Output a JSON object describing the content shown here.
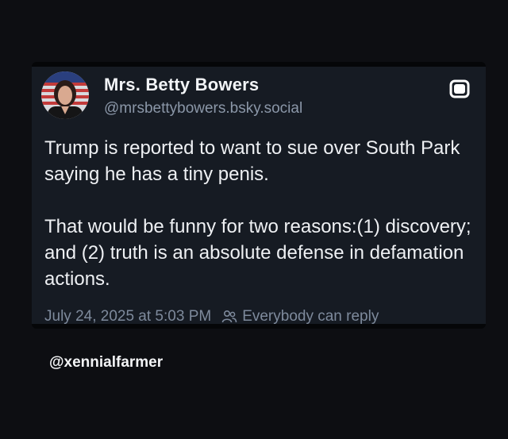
{
  "post": {
    "display_name": "Mrs. Betty Bowers",
    "handle": "@mrsbettybowers.bsky.social",
    "paragraphs": [
      "Trump is reported to want to sue over South Park saying he has a tiny penis.",
      "That would be funny for two reasons:(1) discovery; and (2) truth is an absolute defense in defamation actions."
    ],
    "timestamp": "July 24, 2025 at 5:03 PM",
    "reply_setting": "Everybody can reply",
    "icons": {
      "avatar": "profile-photo",
      "top_right": "bluesky-square-icon",
      "reply_setting": "people-icon"
    }
  },
  "watermark": {
    "text": "@xennialfarmer"
  },
  "colors": {
    "page_background": "#0d0e12",
    "card_background": "#161b23",
    "primary_text": "#eef0f3",
    "secondary_text": "#8b97a8"
  }
}
